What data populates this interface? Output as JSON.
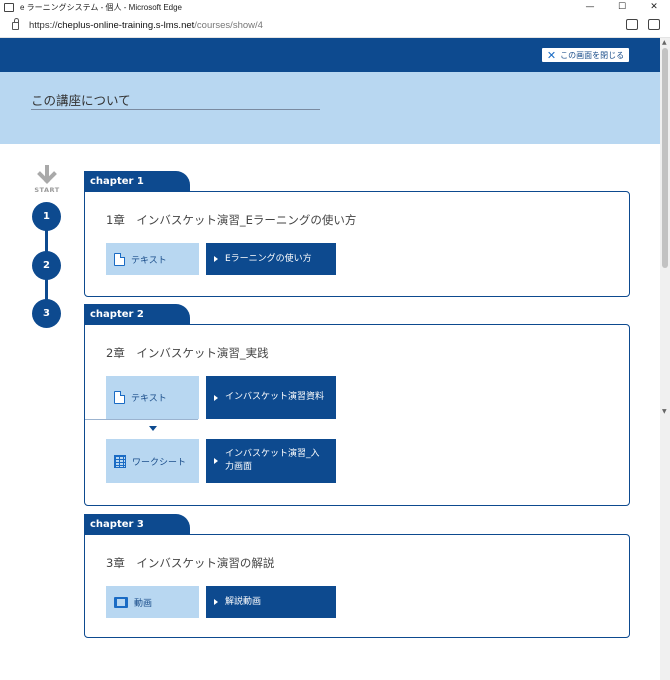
{
  "window": {
    "title": "e ラーニングシステム - 個人 - Microsoft Edge",
    "controls": [
      "—",
      "☐",
      "✕"
    ]
  },
  "address": {
    "url_prefix": "https://",
    "url_host": "cheplus-online-training.s-lms.net",
    "url_path": "/courses/show/4"
  },
  "header": {
    "close_label": "この画面を閉じる",
    "page_title": "この講座について"
  },
  "timeline": {
    "start_label": "START",
    "steps": [
      "1",
      "2",
      "3"
    ]
  },
  "chapters": [
    {
      "tab": "chapter 1",
      "title": "1章　インバスケット演習_Eラーニングの使い方",
      "items": [
        {
          "type_label": "テキスト",
          "type_icon": "document-icon",
          "button_label": "Eラーニングの使い方"
        }
      ]
    },
    {
      "tab": "chapter 2",
      "title": "2章　インバスケット演習_実践",
      "items": [
        {
          "type_label": "テキスト",
          "type_icon": "document-icon",
          "button_label": "インバスケット演習資料"
        },
        {
          "type_label": "ワークシート",
          "type_icon": "worksheet-icon",
          "button_label": "インバスケット演習_入力画面"
        }
      ]
    },
    {
      "tab": "chapter 3",
      "title": "3章　インバスケット演習の解説",
      "items": [
        {
          "type_label": "動画",
          "type_icon": "video-icon",
          "button_label": "解説動画"
        }
      ]
    }
  ],
  "colors": {
    "primary": "#0d4a8f",
    "light": "#b8d7f1",
    "accent": "#1a6bc4"
  }
}
